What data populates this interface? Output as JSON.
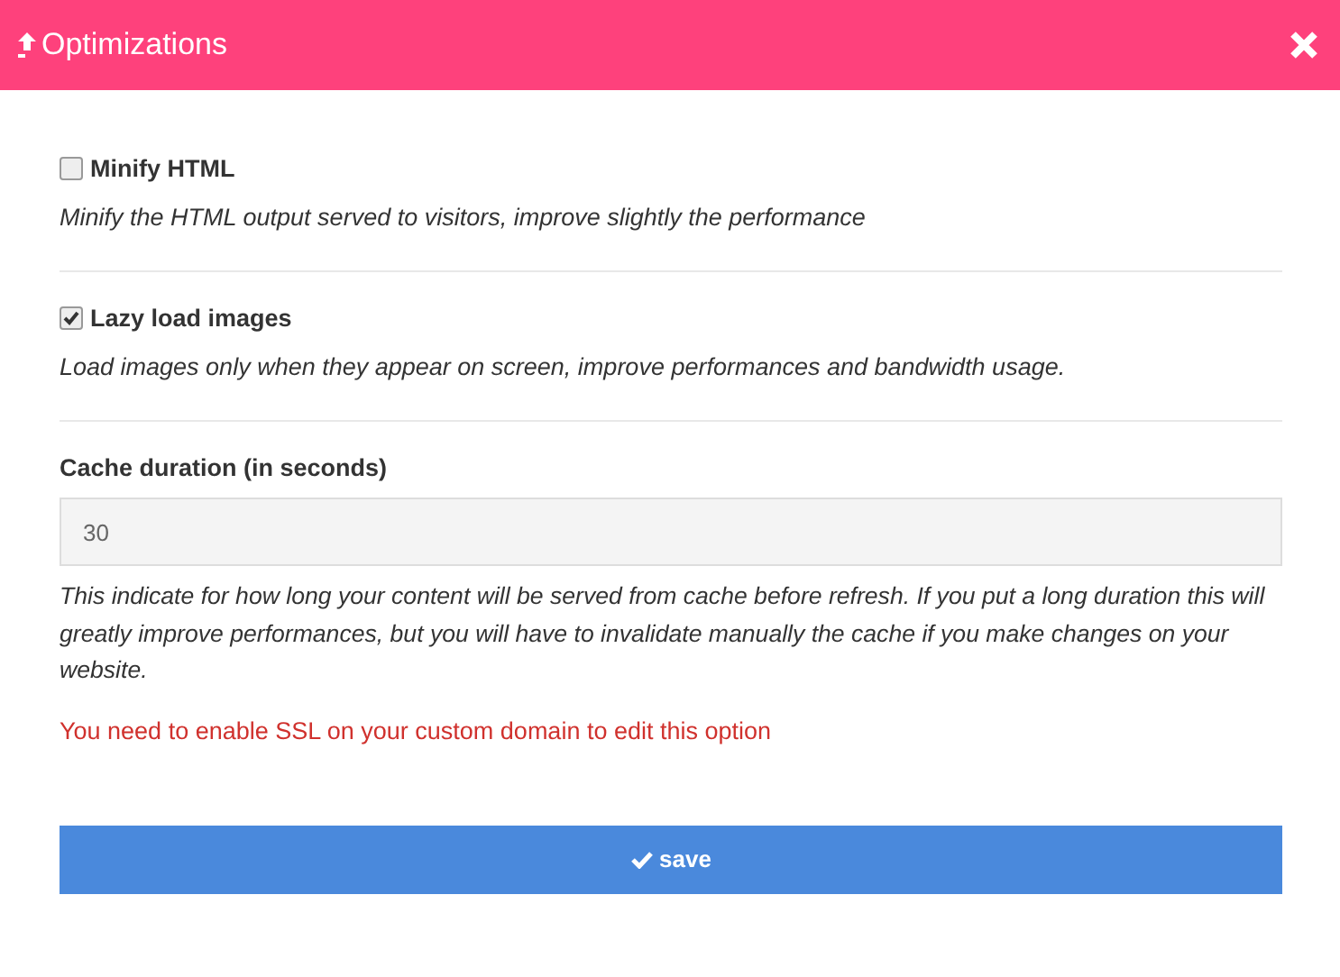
{
  "window": {
    "title": "Optimizations"
  },
  "options": [
    {
      "label": "Minify HTML",
      "checked": false,
      "description": "Minify the HTML output served to visitors, improve slightly the performance"
    },
    {
      "label": "Lazy load images",
      "checked": true,
      "description": "Load images only when they appear on screen, improve performances and bandwidth usage."
    }
  ],
  "cache": {
    "label": "Cache duration (in seconds)",
    "value": "30",
    "disabled": true,
    "help": "This indicate for how long your content will be served from cache before refresh. If you put a long duration this will greatly improve performances, but you will have to invalidate manually the cache if you make changes on your website.",
    "error": "You need to enable SSL on your custom domain to edit this option"
  },
  "buttons": [
    {
      "label": "save"
    }
  ]
}
